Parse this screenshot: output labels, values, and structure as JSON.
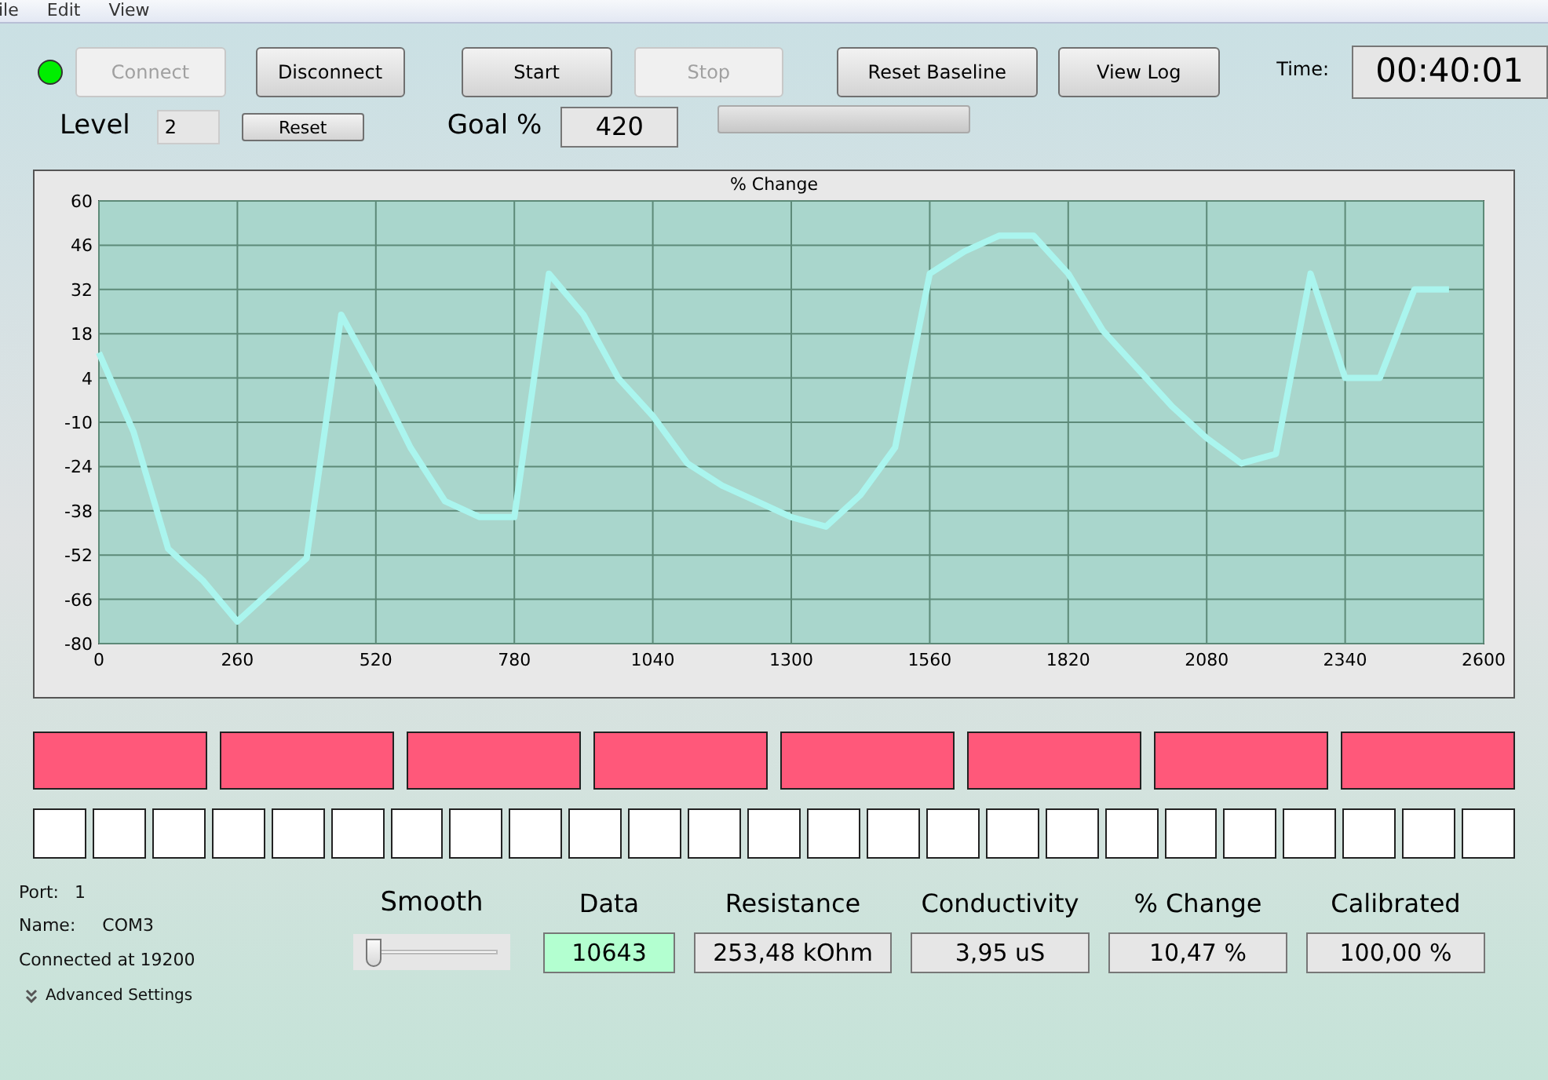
{
  "menu": [
    "ile",
    "Edit",
    "View"
  ],
  "status_led": {
    "on": true
  },
  "buttons": [
    {
      "label": "Connect",
      "disabled": true
    },
    {
      "label": "Disconnect",
      "disabled": false
    },
    {
      "label": "Start",
      "disabled": false
    },
    {
      "label": "Stop",
      "disabled": true
    },
    {
      "label": "Reset Baseline",
      "disabled": false
    },
    {
      "label": "View Log",
      "disabled": false
    }
  ],
  "time": {
    "label": "Time:",
    "value": "00:40:01"
  },
  "level": {
    "label": "Level",
    "value": "2",
    "reset": "Reset"
  },
  "goal": {
    "label": "Goal %",
    "value": "420"
  },
  "progress": {
    "level": 0
  },
  "chart": {
    "chart_data": {
      "type": "line",
      "title": "% Change",
      "grid": true,
      "xlim": [
        0,
        2600
      ],
      "ylim": [
        -80,
        60
      ],
      "xticks": [
        0,
        260,
        520,
        780,
        1040,
        1300,
        1560,
        1820,
        2080,
        2340,
        2600
      ],
      "yticks": [
        60,
        46,
        32,
        18,
        4,
        -10,
        -24,
        -38,
        -52,
        -66,
        -80
      ],
      "x": [
        0,
        65,
        130,
        195,
        260,
        325,
        390,
        455,
        520,
        585,
        650,
        715,
        780,
        845,
        910,
        975,
        1040,
        1105,
        1170,
        1235,
        1300,
        1365,
        1430,
        1495,
        1560,
        1625,
        1690,
        1755,
        1820,
        1885,
        1950,
        2015,
        2080,
        2145,
        2210,
        2275,
        2340,
        2405,
        2470,
        2535
      ],
      "series": [
        {
          "color": "#aaf5ee",
          "values": [
            12,
            -13,
            -50,
            -60,
            -73,
            -63,
            -53,
            24,
            4,
            -18,
            -35,
            -40,
            -40,
            37,
            24,
            4,
            -8,
            -23,
            -30,
            -35,
            -40,
            -43,
            -33,
            -18,
            37,
            44,
            49,
            49,
            37,
            19,
            7,
            -5,
            -15,
            -23,
            -20,
            37,
            4,
            4,
            32,
            32
          ]
        }
      ]
    }
  },
  "bars": [
    {
      "lit": true
    },
    {
      "lit": true
    },
    {
      "lit": true
    },
    {
      "lit": true
    },
    {
      "lit": true
    },
    {
      "lit": true
    },
    {
      "lit": true
    },
    {
      "lit": true
    }
  ],
  "squares": [
    {
      "lit": false
    },
    {
      "lit": false
    },
    {
      "lit": false
    },
    {
      "lit": false
    },
    {
      "lit": false
    },
    {
      "lit": false
    },
    {
      "lit": false
    },
    {
      "lit": false
    },
    {
      "lit": false
    },
    {
      "lit": false
    },
    {
      "lit": false
    },
    {
      "lit": false
    },
    {
      "lit": false
    },
    {
      "lit": false
    },
    {
      "lit": false
    },
    {
      "lit": false
    },
    {
      "lit": false
    },
    {
      "lit": false
    },
    {
      "lit": false
    },
    {
      "lit": false
    },
    {
      "lit": false
    },
    {
      "lit": false
    },
    {
      "lit": false
    },
    {
      "lit": false
    },
    {
      "lit": false
    }
  ],
  "port": {
    "port_label": "Port:",
    "port": "1",
    "name_label": "Name:",
    "name": "COM3",
    "connected": "Connected at 19200",
    "advanced": "Advanced Settings"
  },
  "smooth": {
    "label": "Smooth",
    "level": 0.05
  },
  "readouts": [
    {
      "label": "Data",
      "value": "10643",
      "highlighted": true
    },
    {
      "label": "Resistance",
      "value": "253,48 kOhm",
      "highlighted": false
    },
    {
      "label": "Conductivity",
      "value": "3,95 uS",
      "highlighted": false
    },
    {
      "label": "% Change",
      "value": "10,47 %",
      "highlighted": false
    },
    {
      "label": "Calibrated",
      "value": "100,00 %",
      "highlighted": false
    }
  ]
}
